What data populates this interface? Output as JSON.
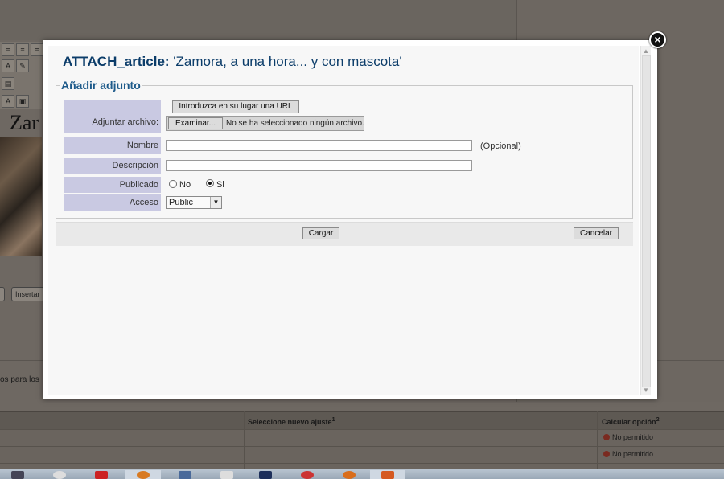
{
  "background": {
    "insert_label": "Insertar",
    "title_fragment": "Zar",
    "paragraph_fragment": "os para los",
    "table": {
      "col1_header": "Seleccione nuevo ajuste",
      "col1_sup": "1",
      "col2_header": "Calcular opción",
      "col2_sup": "2",
      "rows": [
        "No permitido",
        "No permitido"
      ]
    }
  },
  "modal": {
    "title_prefix": "ATTACH_article:",
    "title_quote": "'Zamora, a una hora... y con mascota'",
    "section_legend": "Añadir adjunto",
    "url_button": "Introduzca en su lugar una URL",
    "file_label": "Adjuntar archivo:",
    "browse_button": "Examinar...",
    "no_file_text": "No se ha seleccionado ningún archivo.",
    "name_label": "Nombre",
    "name_value": "",
    "optional_note": "(Opcional)",
    "description_label": "Descripción",
    "description_value": "",
    "published_label": "Publicado",
    "published_no": "No",
    "published_yes": "Si",
    "published_selected": "Si",
    "access_label": "Acceso",
    "access_value": "Public",
    "upload_button": "Cargar",
    "cancel_button": "Cancelar",
    "close_icon": "close-icon"
  }
}
